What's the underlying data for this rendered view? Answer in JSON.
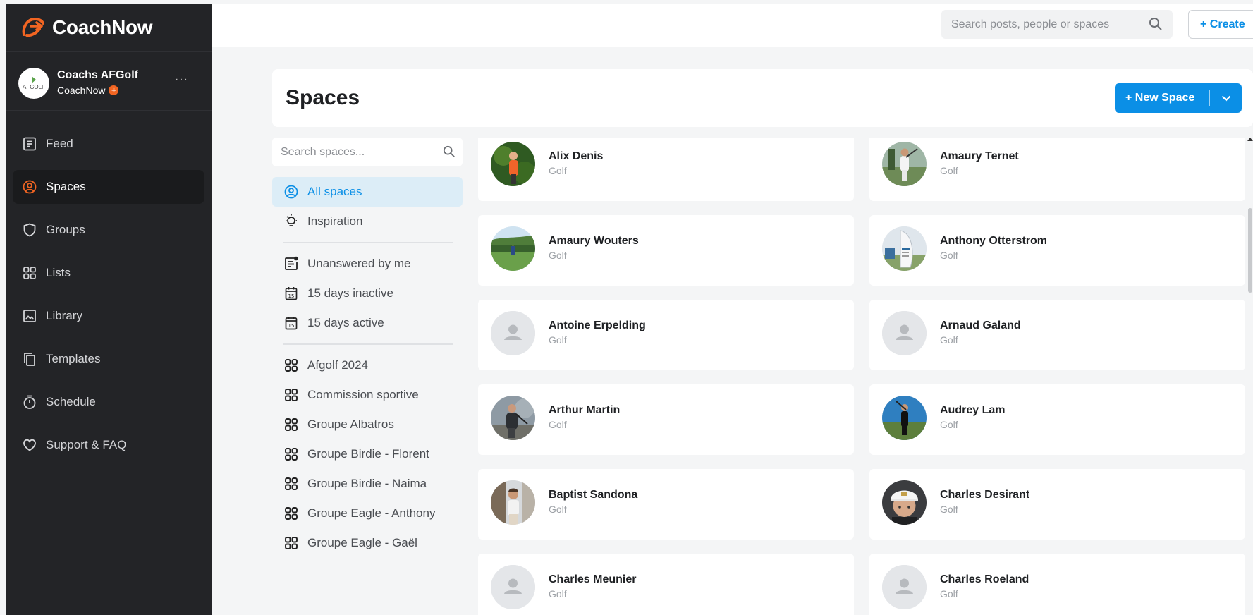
{
  "brand": {
    "name": "CoachNow",
    "accent": "#f26522"
  },
  "account": {
    "name": "Coachs AFGolf",
    "subtitle": "CoachNow",
    "avatar_label": "AFGOLF",
    "plus_badge": "+",
    "more": "···"
  },
  "nav": {
    "items": [
      {
        "label": "Feed",
        "icon": "feed-icon"
      },
      {
        "label": "Spaces",
        "icon": "spaces-icon",
        "active": true
      },
      {
        "label": "Groups",
        "icon": "shield-icon"
      },
      {
        "label": "Lists",
        "icon": "grid-icon"
      },
      {
        "label": "Library",
        "icon": "image-icon"
      },
      {
        "label": "Templates",
        "icon": "copy-icon"
      },
      {
        "label": "Schedule",
        "icon": "timer-icon"
      },
      {
        "label": "Support & FAQ",
        "icon": "heart-icon"
      }
    ]
  },
  "topbar": {
    "search_placeholder": "Search posts, people or spaces",
    "create_label": "+ Create"
  },
  "header": {
    "title": "Spaces",
    "new_space_label": "+ New Space"
  },
  "filters": {
    "search_placeholder": "Search spaces...",
    "primary": [
      {
        "label": "All spaces",
        "icon": "user-circle-icon",
        "active": true
      },
      {
        "label": "Inspiration",
        "icon": "lightbulb-icon"
      }
    ],
    "smart": [
      {
        "label": "Unanswered by me",
        "icon": "unanswered-icon"
      },
      {
        "label": "15 days inactive",
        "icon": "calendar-icon",
        "day": "15"
      },
      {
        "label": "15 days active",
        "icon": "calendar-icon",
        "day": "15"
      }
    ],
    "lists": [
      {
        "label": "Afgolf 2024"
      },
      {
        "label": "Commission sportive"
      },
      {
        "label": "Groupe Albatros"
      },
      {
        "label": "Groupe Birdie - Florent"
      },
      {
        "label": "Groupe Birdie - Naima"
      },
      {
        "label": "Groupe Eagle - Anthony"
      },
      {
        "label": "Groupe Eagle - Gaël"
      }
    ]
  },
  "spaces": [
    {
      "name": "Alix Denis",
      "sport": "Golf",
      "photo": "orange-golfer"
    },
    {
      "name": "Amaury Ternet",
      "sport": "Golf",
      "photo": "swing-golfer"
    },
    {
      "name": "Amaury Wouters",
      "sport": "Golf",
      "photo": "course-golfer"
    },
    {
      "name": "Anthony Otterstrom",
      "sport": "Golf",
      "photo": "banner"
    },
    {
      "name": "Antoine Erpelding",
      "sport": "Golf",
      "photo": "placeholder"
    },
    {
      "name": "Arnaud Galand",
      "sport": "Golf",
      "photo": "placeholder"
    },
    {
      "name": "Arthur Martin",
      "sport": "Golf",
      "photo": "dark-golfer"
    },
    {
      "name": "Audrey Lam",
      "sport": "Golf",
      "photo": "sky-golfer"
    },
    {
      "name": "Baptist Sandona",
      "sport": "Golf",
      "photo": "kid-golfer"
    },
    {
      "name": "Charles Desirant",
      "sport": "Golf",
      "photo": "cap-kid"
    },
    {
      "name": "Charles Meunier",
      "sport": "Golf",
      "photo": "placeholder"
    },
    {
      "name": "Charles Roeland",
      "sport": "Golf",
      "photo": "placeholder"
    }
  ]
}
